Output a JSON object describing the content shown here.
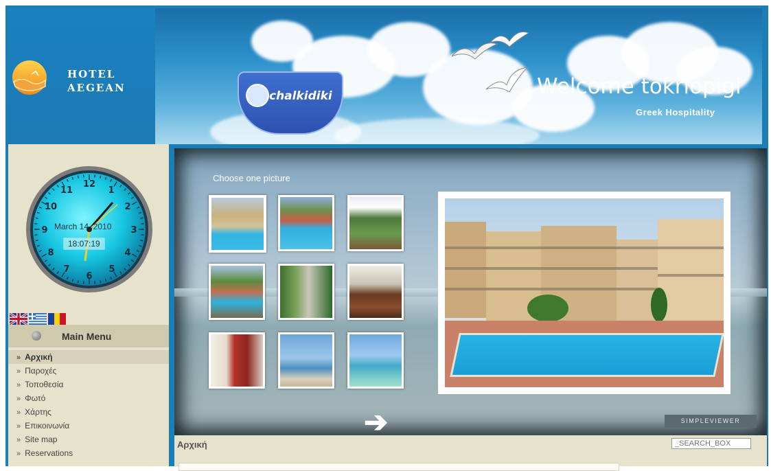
{
  "logo": {
    "line1": "HOTEL",
    "line2": "AEGEAN"
  },
  "banner": {
    "badge_text": "chalkidiki",
    "welcome": "Welcome tokriopigi",
    "tagline": "Greek Hospitality"
  },
  "clock": {
    "date": "March 14, 2010",
    "time": "18:07:19"
  },
  "flags": [
    {
      "name": "uk-flag-icon"
    },
    {
      "name": "greece-flag-icon"
    },
    {
      "name": "romania-flag-icon"
    }
  ],
  "menu": {
    "title": "Main Menu",
    "items": [
      {
        "label": "Αρχική",
        "active": true
      },
      {
        "label": "Παροχές"
      },
      {
        "label": "Τοποθεσία"
      },
      {
        "label": "Φωτό"
      },
      {
        "label": "Χάρτης"
      },
      {
        "label": "Επικοινωνία"
      },
      {
        "label": "Site map"
      },
      {
        "label": "Reservations"
      }
    ]
  },
  "gallery": {
    "prompt": "Choose one picture",
    "thumbnail_count": 9,
    "selected": 1,
    "badge": "SIMPLEVIEWER"
  },
  "content": {
    "title": "Αρχική",
    "search_placeholder": "_SEARCH_BOX"
  }
}
